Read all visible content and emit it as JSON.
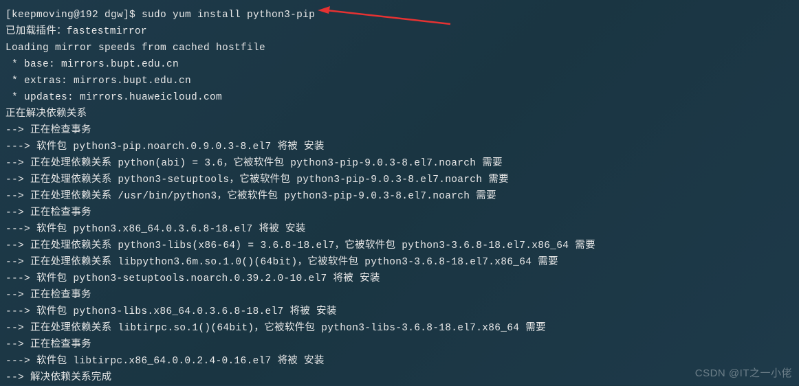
{
  "prompt": "[keepmoving@192 dgw]$ ",
  "command": "sudo yum install python3-pip",
  "lines": [
    "已加载插件：fastestmirror",
    "Loading mirror speeds from cached hostfile",
    " * base: mirrors.bupt.edu.cn",
    " * extras: mirrors.bupt.edu.cn",
    " * updates: mirrors.huaweicloud.com",
    "正在解决依赖关系",
    "--> 正在检查事务",
    "---> 软件包 python3-pip.noarch.0.9.0.3-8.el7 将被 安装",
    "--> 正在处理依赖关系 python(abi) = 3.6，它被软件包 python3-pip-9.0.3-8.el7.noarch 需要",
    "--> 正在处理依赖关系 python3-setuptools，它被软件包 python3-pip-9.0.3-8.el7.noarch 需要",
    "--> 正在处理依赖关系 /usr/bin/python3，它被软件包 python3-pip-9.0.3-8.el7.noarch 需要",
    "--> 正在检查事务",
    "---> 软件包 python3.x86_64.0.3.6.8-18.el7 将被 安装",
    "--> 正在处理依赖关系 python3-libs(x86-64) = 3.6.8-18.el7，它被软件包 python3-3.6.8-18.el7.x86_64 需要",
    "--> 正在处理依赖关系 libpython3.6m.so.1.0()(64bit)，它被软件包 python3-3.6.8-18.el7.x86_64 需要",
    "---> 软件包 python3-setuptools.noarch.0.39.2.0-10.el7 将被 安装",
    "--> 正在检查事务",
    "---> 软件包 python3-libs.x86_64.0.3.6.8-18.el7 将被 安装",
    "--> 正在处理依赖关系 libtirpc.so.1()(64bit)，它被软件包 python3-libs-3.6.8-18.el7.x86_64 需要",
    "--> 正在检查事务",
    "---> 软件包 libtirpc.x86_64.0.0.2.4-0.16.el7 将被 安装",
    "--> 解决依赖关系完成"
  ],
  "watermark": "CSDN @IT之一小佬",
  "arrow_color": "#e63232"
}
